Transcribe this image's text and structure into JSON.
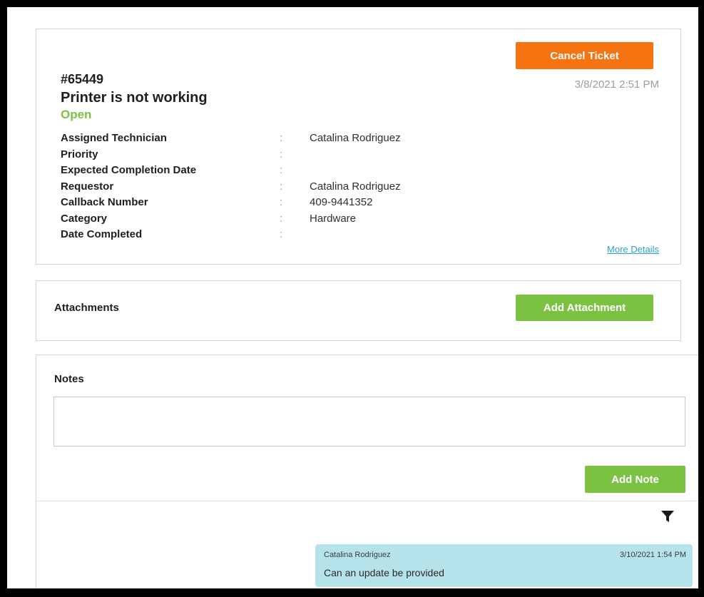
{
  "ticket": {
    "id": "#65449",
    "title": "Printer is not working",
    "status": "Open",
    "created": "3/8/2021 2:51 PM",
    "cancel_label": "Cancel Ticket",
    "more_details_label": "More Details",
    "separator": ":",
    "details": [
      {
        "label": "Assigned Technician",
        "value": "Catalina Rodriguez"
      },
      {
        "label": "Priority",
        "value": ""
      },
      {
        "label": "Expected Completion Date",
        "value": ""
      },
      {
        "label": "Requestor",
        "value": "Catalina Rodriguez"
      },
      {
        "label": "Callback Number",
        "value": "409-9441352"
      },
      {
        "label": "Category",
        "value": "Hardware"
      },
      {
        "label": "Date Completed",
        "value": ""
      }
    ]
  },
  "attachments": {
    "label": "Attachments",
    "add_label": "Add Attachment"
  },
  "notes": {
    "label": "Notes",
    "input_value": "",
    "input_placeholder": "",
    "add_label": "Add Note",
    "filter_icon": "filter-icon",
    "items": [
      {
        "author": "Catalina Rodriguez",
        "time": "3/10/2021 1:54 PM",
        "text": "Can an update be provided"
      }
    ]
  },
  "colors": {
    "accent_orange": "#f57310",
    "accent_green": "#7cc242",
    "status_open": "#7cc242",
    "link": "#2ba3c7",
    "note_bubble": "#b6e3ea",
    "frame_border": "#000000"
  }
}
